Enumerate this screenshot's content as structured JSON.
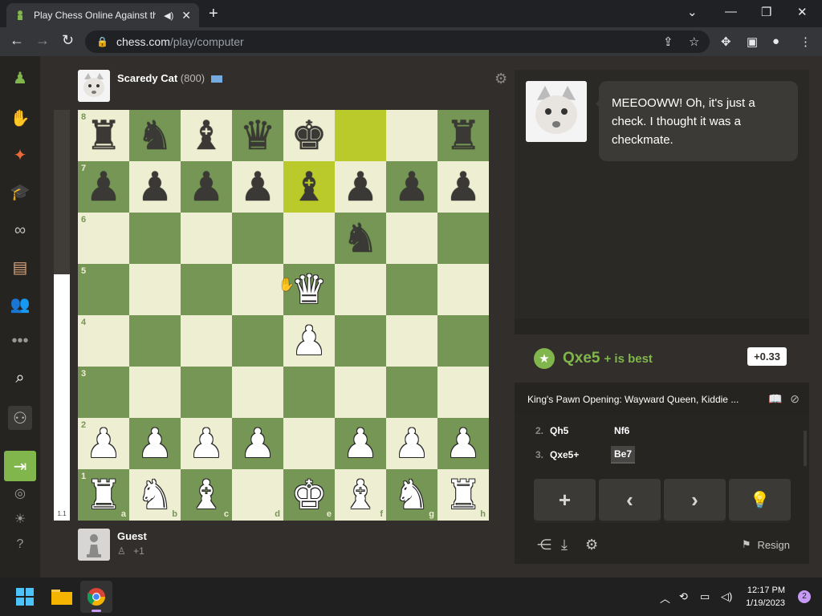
{
  "browser": {
    "tab_title": "Play Chess Online Against th",
    "url_host": "chess.com",
    "url_path": "/play/computer"
  },
  "opponent": {
    "name": "Scaredy Cat",
    "rating": "(800)"
  },
  "player": {
    "name": "Guest",
    "captured": "+1"
  },
  "board": {
    "ranks": [
      "8",
      "7",
      "6",
      "5",
      "4",
      "3",
      "2",
      "1"
    ],
    "files": [
      "a",
      "b",
      "c",
      "d",
      "e",
      "f",
      "g",
      "h"
    ],
    "position": [
      [
        "r",
        "n",
        "b",
        "q",
        "k",
        "",
        "",
        "r"
      ],
      [
        "p",
        "p",
        "p",
        "p",
        "b",
        "p",
        "p",
        "p"
      ],
      [
        "",
        "",
        "",
        "",
        "",
        "n",
        "",
        ""
      ],
      [
        "",
        "",
        "",
        "",
        "Q",
        "",
        "",
        ""
      ],
      [
        "",
        "",
        "",
        "",
        "P",
        "",
        "",
        ""
      ],
      [
        "",
        "",
        "",
        "",
        "",
        "",
        "",
        ""
      ],
      [
        "P",
        "P",
        "P",
        "P",
        "",
        "P",
        "P",
        "P"
      ],
      [
        "R",
        "N",
        "B",
        "",
        "K",
        "B",
        "N",
        "R"
      ]
    ],
    "highlights": [
      "f8",
      "e7"
    ]
  },
  "eval_bar": {
    "value": "1.1",
    "white_fraction": 0.6
  },
  "coach": {
    "message": "MEEOOWW! Oh, it's just a check. I thought it was a checkmate."
  },
  "analysis": {
    "best_move": "Qxe5",
    "best_suffix": "+ is best",
    "eval": "+0.33"
  },
  "opening": "King's Pawn Opening: Wayward Queen, Kiddie ...",
  "moves": [
    {
      "num": "2.",
      "white": "Qh5",
      "black": "Nf6"
    },
    {
      "num": "3.",
      "white": "Qxe5+",
      "black": "Be7"
    }
  ],
  "controls": {
    "resign_label": "Resign"
  },
  "taskbar": {
    "time": "12:17 PM",
    "date": "1/19/2023",
    "notif_count": "2"
  }
}
